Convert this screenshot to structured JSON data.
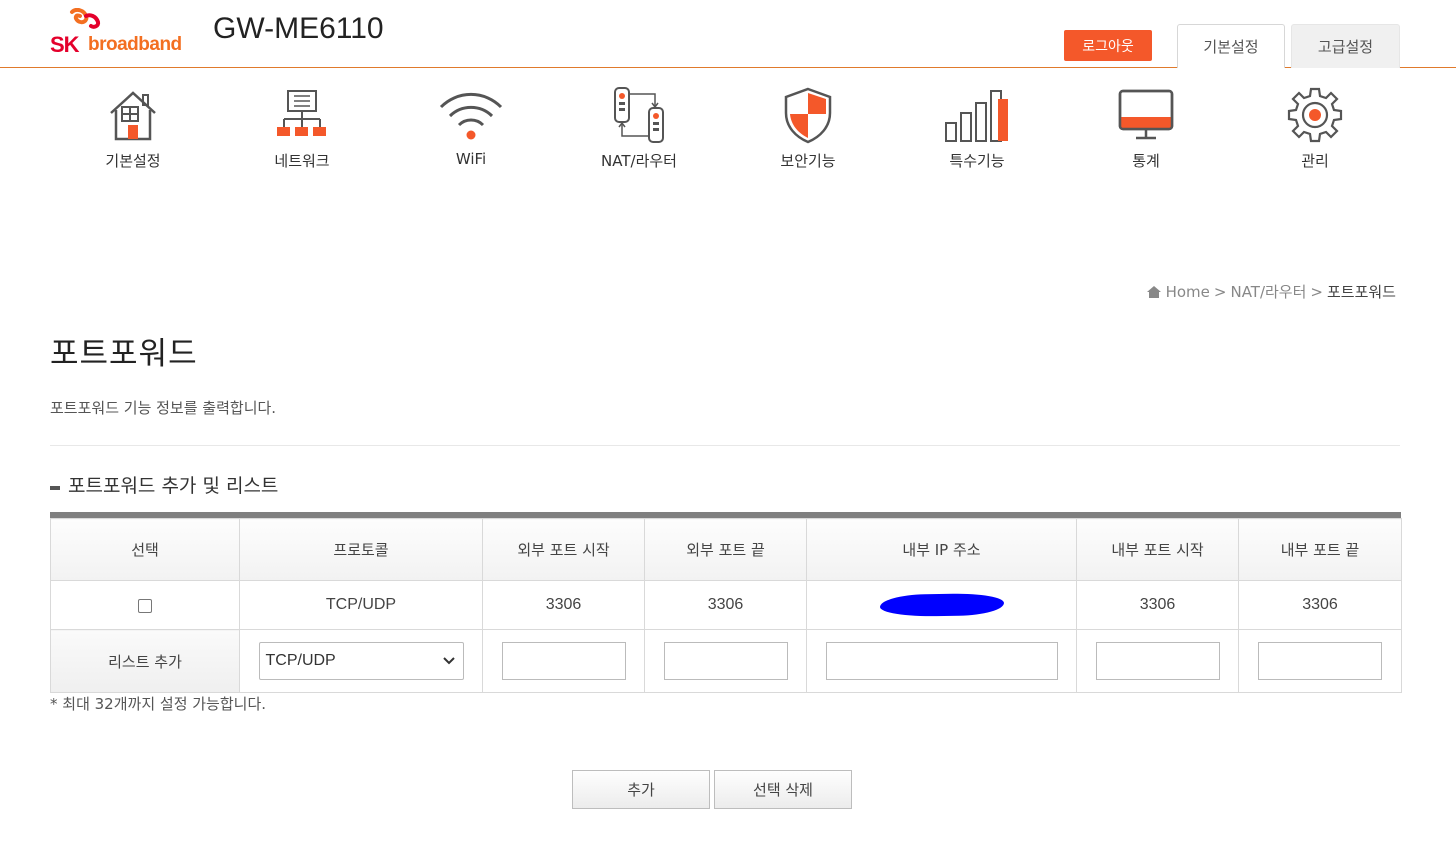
{
  "header": {
    "logo_sk": "SK",
    "logo_broadband": "broadband",
    "model": "GW-ME6110",
    "logout_label": "로그아웃",
    "tab_basic": "기본설정",
    "tab_advanced": "고급설정",
    "brand_color": "#f4582a"
  },
  "nav": {
    "items": [
      {
        "label": "기본설정",
        "icon": "house-icon"
      },
      {
        "label": "네트워크",
        "icon": "network-icon"
      },
      {
        "label": "WiFi",
        "icon": "wifi-icon"
      },
      {
        "label": "NAT/라우터",
        "icon": "nat-router-icon"
      },
      {
        "label": "보안기능",
        "icon": "shield-icon"
      },
      {
        "label": "특수기능",
        "icon": "bar-chart-icon"
      },
      {
        "label": "통계",
        "icon": "monitor-icon"
      },
      {
        "label": "관리",
        "icon": "gear-icon"
      }
    ]
  },
  "breadcrumb": {
    "home": "Home",
    "sep": ">",
    "level1": "NAT/라우터",
    "current": "포트포워드"
  },
  "page": {
    "title": "포트포워드",
    "description": "포트포워드 기능 정보를 출력합니다.",
    "section_title": "포트포워드 추가 및 리스트",
    "note": "* 최대 32개까지 설정 가능합니다."
  },
  "table": {
    "headers": [
      "선택",
      "프로토콜",
      "외부 포트 시작",
      "외부 포트 끝",
      "내부 IP 주소",
      "내부 포트 시작",
      "내부 포트 끝"
    ],
    "rows": [
      {
        "protocol": "TCP/UDP",
        "ext_start": "3306",
        "ext_end": "3306",
        "int_start": "3306",
        "int_end": "3306"
      }
    ],
    "add_row_label": "리스트 추가",
    "add_row_protocol": "TCP/UDP"
  },
  "buttons": {
    "add": "추가",
    "delete_selected": "선택 삭제"
  }
}
